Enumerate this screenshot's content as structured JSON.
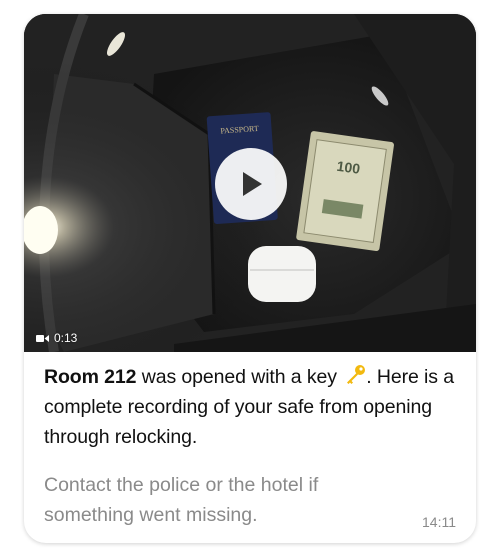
{
  "video": {
    "duration": "0:13",
    "duration_icon": "video-camera-icon",
    "play_icon": "play-icon",
    "scene": {
      "passport_label": "PASSPORT",
      "banknote_label": "100"
    }
  },
  "message": {
    "room": "Room 212",
    "text_after_room": " was opened with a key ",
    "key_icon": "key-icon",
    "text_end": ". Here is a complete recording of your safe from opening through relocking.",
    "secondary": "Contact the police or the hotel if something went missing.",
    "timestamp": "14:11"
  },
  "colors": {
    "bubble_bg": "#ffffff",
    "primary_text": "#111111",
    "secondary_text": "#8a8a8a",
    "key": "#f2b90f"
  }
}
